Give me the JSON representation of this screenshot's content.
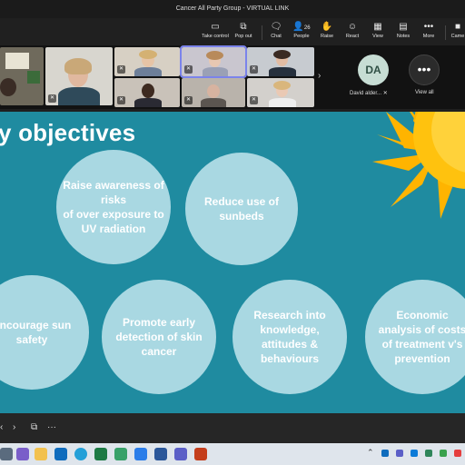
{
  "window": {
    "title": "Cancer All Party Group - VIRTUAL LINK"
  },
  "toolbar": {
    "take_control": "Take control",
    "pop_out": "Pop out",
    "chat": "Chat",
    "people": "People",
    "people_count": "26",
    "raise": "Raise",
    "react": "React",
    "view": "View",
    "notes": "Notes",
    "more": "More",
    "camera": "Came"
  },
  "participants": {
    "avatar_initials": "DA",
    "avatar_name": "David alder...",
    "view_all": "View all"
  },
  "slide": {
    "title": "y objectives",
    "objectives": [
      "Raise awareness of\nrisks\nof over exposure to\nUV radiation",
      "Reduce use of\nsunbeds",
      "Encourage sun\nsafety",
      "Promote early\ndetection of skin\ncancer",
      "Research into\nknowledge,\nattitudes &\nbehaviours",
      "Economic\nanalysis of costs\nof treatment v's\nprevention"
    ]
  },
  "colors": {
    "slide_bg": "#1f8ba0",
    "circle": "#a9d8e2",
    "sun": "#ffc20e",
    "taskbar": "#dfe5ec"
  }
}
